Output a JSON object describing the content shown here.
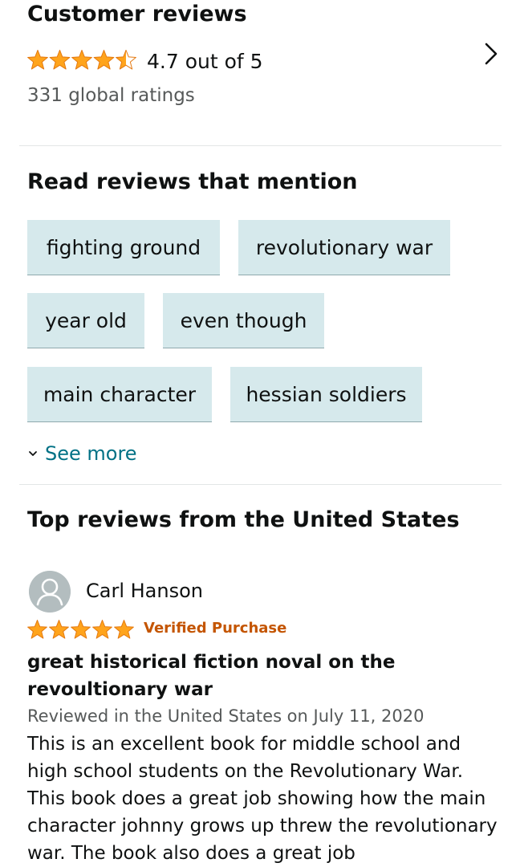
{
  "customer_reviews": {
    "title": "Customer reviews",
    "average_rating": 4.7,
    "rating_text": "4.7 out of 5",
    "global_ratings": "331 global ratings",
    "star_color": "#ffa41c"
  },
  "mentions": {
    "title": "Read reviews that mention",
    "chips": [
      "fighting ground",
      "revolutionary war",
      "year old",
      "even though",
      "main character",
      "hessian soldiers"
    ],
    "see_more": "See more"
  },
  "top_reviews": {
    "title": "Top reviews from the United States",
    "reviews": [
      {
        "reviewer": "Carl Hanson",
        "stars": 5,
        "badge": "Verified Purchase",
        "title": "great historical fiction noval on the revoultionary war",
        "date_line": "Reviewed in the United States on July 11, 2020",
        "body": "This is an excellent book for middle school and high school students on the Revolutionary War. This book does a great job showing how the main character johnny grows up threw the revolutionary war. The book also does a great job"
      }
    ]
  },
  "colors": {
    "chip_bg": "#d6e9ec",
    "link": "#007185",
    "verified": "#c45500"
  }
}
